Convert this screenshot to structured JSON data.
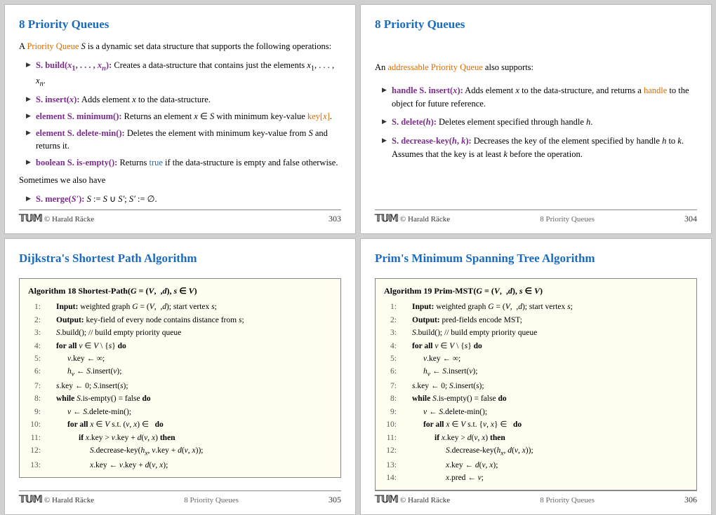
{
  "slides": [
    {
      "id": "slide1",
      "title": "8 Priority Queues",
      "page": "303",
      "footer_author": "© Harald Räcke",
      "footer_section": "",
      "content": {
        "intro": "A Priority Queue S is a dynamic set data structure that supports the following operations:",
        "bullets": [
          {
            "bold": "S. build(x₁, . . . , xₙ):",
            "rest": " Creates a data-structure that contains just the elements x₁, . . . , xₙ."
          },
          {
            "bold": "S. insert(x):",
            "rest": " Adds element x to the data-structure."
          },
          {
            "bold": "element S. minimum():",
            "rest": " Returns an element x ∈ S with minimum key-value key[x]."
          },
          {
            "bold": "element S. delete-min():",
            "rest": " Deletes the element with minimum key-value from S and returns it."
          },
          {
            "bold": "boolean S. is-empty():",
            "rest": " Returns true if the data-structure is empty and false otherwise."
          }
        ],
        "sometimes": "Sometimes we also have",
        "merge_bullet": {
          "bold": "S. merge(S′):",
          "rest": " S := S ∪ S′; S′ := ∅."
        }
      }
    },
    {
      "id": "slide2",
      "title": "8 Priority Queues",
      "page": "304",
      "footer_author": "© Harald Räcke",
      "footer_section": "8 Priority Queues",
      "content": {
        "intro": "An addressable Priority Queue also supports:",
        "bullets": [
          {
            "bold": "handle S. insert(x):",
            "rest": " Adds element x to the data-structure, and returns a handle to the object for future reference."
          },
          {
            "bold": "S. delete(h):",
            "rest": " Deletes element specified through handle h."
          },
          {
            "bold": "S. decrease-key(h, k):",
            "rest": " Decreases the key of the element specified by handle h to k. Assumes that the key is at least k before the operation."
          }
        ]
      }
    },
    {
      "id": "slide3",
      "title": "Dijkstra's Shortest Path Algorithm",
      "page": "305",
      "footer_author": "© Harald Räcke",
      "footer_section": "8 Priority Queues",
      "algo": {
        "title": "Algorithm 18 Shortest-Path(G = (V,  ,d), s ∈ V)",
        "lines": [
          {
            "num": "1:",
            "indent": 1,
            "text": "Input: weighted graph G = (V,  ,d); start vertex s;"
          },
          {
            "num": "2:",
            "indent": 1,
            "text": "Output: key-field of every node contains distance from s;"
          },
          {
            "num": "3:",
            "indent": 1,
            "text": "S.build(); // build empty priority queue"
          },
          {
            "num": "4:",
            "indent": 1,
            "kw": "for all",
            "text": " v ∈ V \\ {s} do"
          },
          {
            "num": "5:",
            "indent": 2,
            "text": "v.key ← ∞;"
          },
          {
            "num": "6:",
            "indent": 2,
            "text": "hᵥ ← S.insert(v);"
          },
          {
            "num": "7:",
            "indent": 1,
            "text": "s.key ← 0; S.insert(s);"
          },
          {
            "num": "8:",
            "indent": 1,
            "kw": "while",
            "text": " S.is-empty() = false do"
          },
          {
            "num": "9:",
            "indent": 2,
            "text": "v ← S.delete-min();"
          },
          {
            "num": "10:",
            "indent": 2,
            "kw": "for all",
            "text": " x ∈ V s.t. (v, x) ∈   do"
          },
          {
            "num": "11:",
            "indent": 3,
            "kw": "if",
            "text": " x.key > v.key + d(v, x) then"
          },
          {
            "num": "12:",
            "indent": 4,
            "text": "S.decrease-key(hₓ, v.key + d(v, x));"
          },
          {
            "num": "13:",
            "indent": 4,
            "text": "x.key ← v.key + d(v, x);"
          }
        ]
      }
    },
    {
      "id": "slide4",
      "title": "Prim's Minimum Spanning Tree Algorithm",
      "page": "306",
      "footer_author": "© Harald Räcke",
      "footer_section": "8 Priority Queues",
      "algo": {
        "title": "Algorithm 19 Prim-MST(G = (V,  ,d), s ∈ V)",
        "lines": [
          {
            "num": "1:",
            "indent": 1,
            "text": "Input: weighted graph G = (V,  ,d); start vertex s;"
          },
          {
            "num": "2:",
            "indent": 1,
            "text": "Output: pred-fields encode MST;"
          },
          {
            "num": "3:",
            "indent": 1,
            "text": "S.build(); // build empty priority queue"
          },
          {
            "num": "4:",
            "indent": 1,
            "kw": "for all",
            "text": " v ∈ V \\ {s} do"
          },
          {
            "num": "5:",
            "indent": 2,
            "text": "v.key ← ∞;"
          },
          {
            "num": "6:",
            "indent": 2,
            "text": "hᵥ ← S.insert(v);"
          },
          {
            "num": "7:",
            "indent": 1,
            "text": "s.key ← 0; S.insert(s);"
          },
          {
            "num": "8:",
            "indent": 1,
            "kw": "while",
            "text": " S.is-empty() = false do"
          },
          {
            "num": "9:",
            "indent": 2,
            "text": "v ← S.delete-min();"
          },
          {
            "num": "10:",
            "indent": 2,
            "kw": "for all",
            "text": " x ∈ V s.t. {v, x} ∈   do"
          },
          {
            "num": "11:",
            "indent": 3,
            "kw": "if",
            "text": " x.key > d(v, x) then"
          },
          {
            "num": "12:",
            "indent": 4,
            "text": "S.decrease-key(hₓ, d(v, x));"
          },
          {
            "num": "13:",
            "indent": 4,
            "text": "x.key ← d(v, x);"
          },
          {
            "num": "14:",
            "indent": 4,
            "text": "x.pred ← v;"
          }
        ]
      }
    }
  ]
}
